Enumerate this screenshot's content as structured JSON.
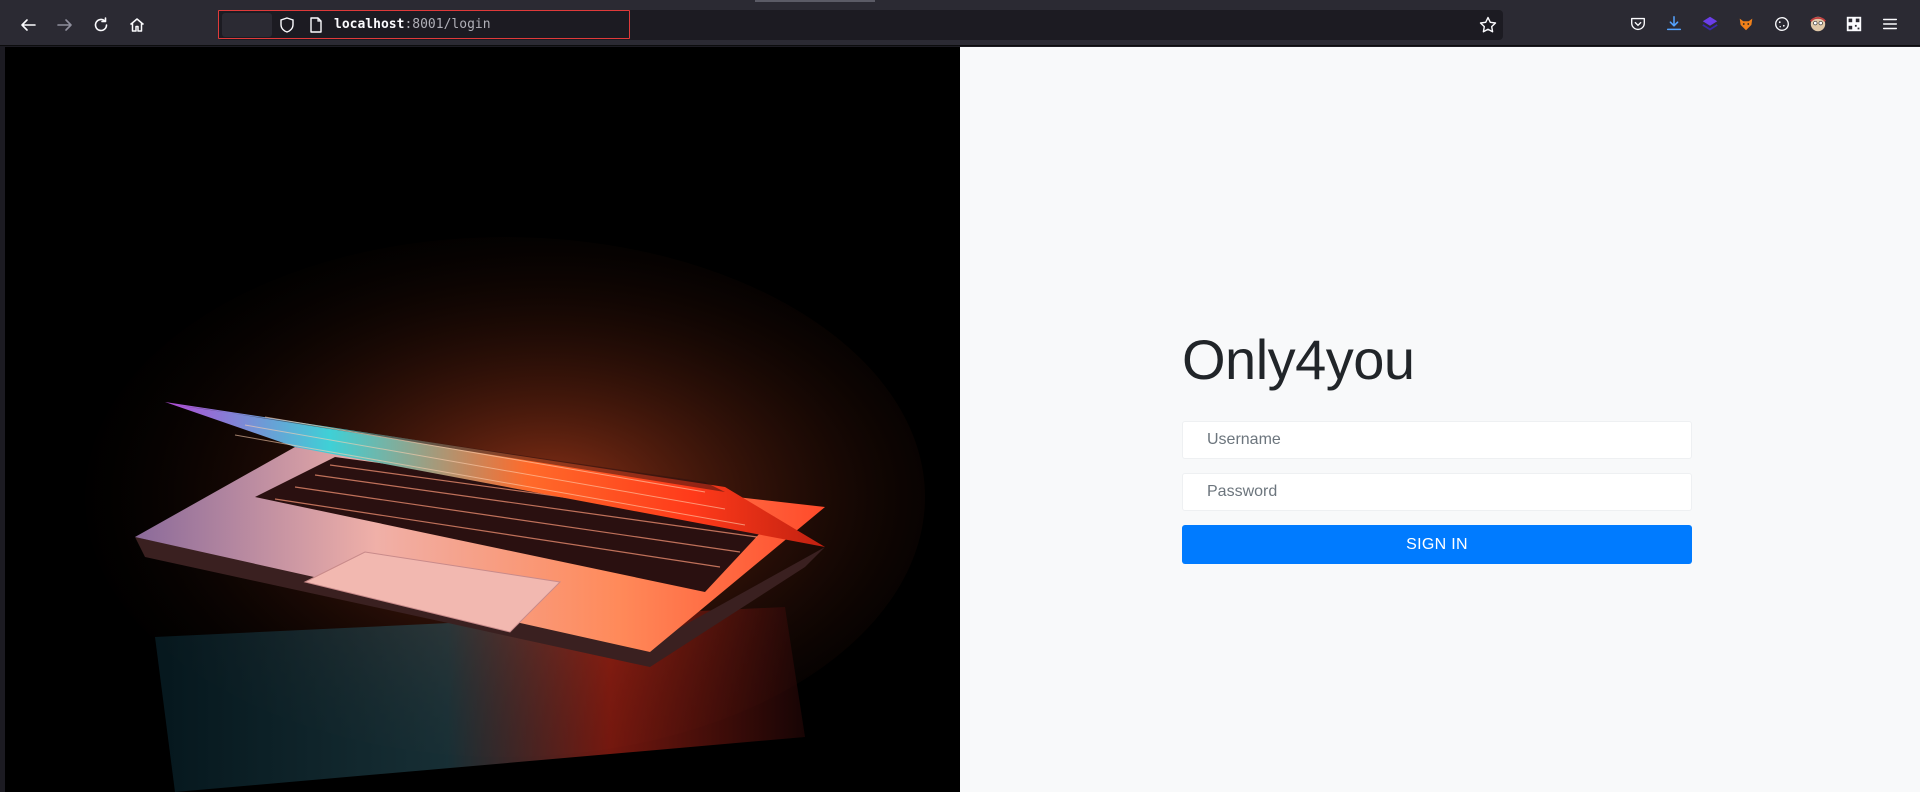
{
  "browser": {
    "url_host": "localhost",
    "url_rest": ":8001/login",
    "icons": [
      "back-icon",
      "forward-icon",
      "reload-icon",
      "home-icon",
      "shield-icon",
      "page-icon",
      "star-icon",
      "pocket-icon",
      "downloads-icon",
      "extension-icon",
      "extension-fox-icon",
      "cookie-icon",
      "extension-avatar-icon",
      "qr-icon",
      "menu-icon"
    ]
  },
  "login": {
    "brand": "Only4you",
    "username_placeholder": "Username",
    "password_placeholder": "Password",
    "signin_label": "SIGN IN"
  },
  "colors": {
    "primary": "#007bff",
    "pane_bg": "#f8f9fa",
    "chrome_bg": "#2b2a33",
    "url_highlight": "#e03a3a"
  }
}
